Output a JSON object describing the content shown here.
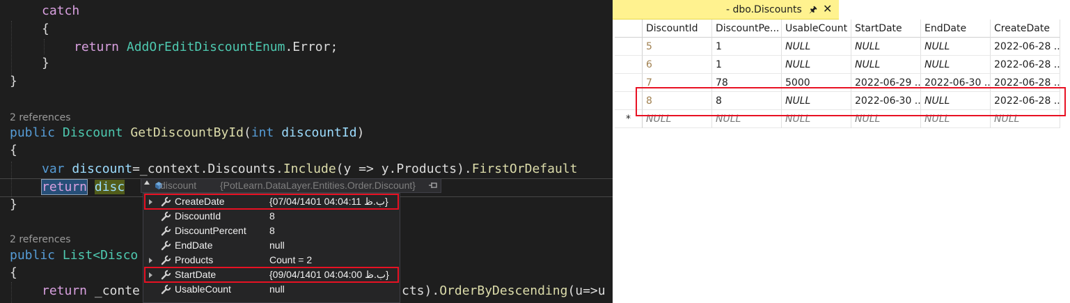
{
  "editor": {
    "code": {
      "catch_kw": "catch",
      "open_brace": "{",
      "close_brace": "}",
      "return_kw": "return",
      "enum_type": "AddOrEditDiscountEnum",
      "enum_tail": ".Error;",
      "refs_1": "2 references",
      "public_kw": "public",
      "discount_type": "Discount",
      "method_1": "GetDiscountById",
      "paren_open": "(",
      "int_kw": "int",
      "param_1": "discountId",
      "paren_close": ")",
      "var_kw": "var",
      "var_name": "discount",
      "ctx_text": "=_context.Discounts.",
      "include_m": "Include",
      "lambda_text": "(y => y.Products).",
      "first_m": "FirstOrDefault",
      "return_sel": "return",
      "disc_sel": "disc",
      "refs_2": "2 references",
      "list_type": "List",
      "list_tail": "<Disco",
      "conte": "_conte",
      "cts_tail": "cts).",
      "order_m": "OrderByDescending",
      "order_tail": "(u=>u"
    },
    "datatip": {
      "header_name": "discount",
      "header_value": "{PotLearn.DataLayer.Entities.Order.Discount}",
      "rows": [
        {
          "name": "CreateDate",
          "value": "{07/04/1401 04:04:11 ب.ظ}",
          "expandable": true,
          "highlighted": true
        },
        {
          "name": "DiscountId",
          "value": "8",
          "expandable": false,
          "highlighted": false
        },
        {
          "name": "DiscountPercent",
          "value": "8",
          "expandable": false,
          "highlighted": false
        },
        {
          "name": "EndDate",
          "value": "null",
          "expandable": false,
          "highlighted": false
        },
        {
          "name": "Products",
          "value": "Count = 2",
          "expandable": true,
          "highlighted": false
        },
        {
          "name": "StartDate",
          "value": "{09/04/1401 04:04:00 ب.ظ}",
          "expandable": true,
          "highlighted": true
        },
        {
          "name": "UsableCount",
          "value": "null",
          "expandable": false,
          "highlighted": false
        }
      ]
    }
  },
  "results": {
    "tab_title": "- dbo.Discounts",
    "pin_icon": "pin-icon",
    "close_icon": "close-icon",
    "columns": [
      "DiscountId",
      "DiscountPe...",
      "UsableCount",
      "StartDate",
      "EndDate",
      "CreateDate"
    ],
    "rows": [
      {
        "marker": "",
        "cells": [
          "5",
          "1",
          "NULL",
          "NULL",
          "NULL",
          "2022-06-28 ..."
        ]
      },
      {
        "marker": "",
        "cells": [
          "6",
          "1",
          "NULL",
          "NULL",
          "NULL",
          "2022-06-28 ..."
        ]
      },
      {
        "marker": "",
        "cells": [
          "7",
          "78",
          "5000",
          "2022-06-29 ...",
          "2022-06-30 ...",
          "2022-06-28 ..."
        ]
      },
      {
        "marker": "",
        "cells": [
          "8",
          "8",
          "NULL",
          "2022-06-30 ...",
          "NULL",
          "2022-06-28 ..."
        ]
      },
      {
        "marker": "*",
        "cells": [
          "NULL",
          "NULL",
          "NULL",
          "NULL",
          "NULL",
          "NULL"
        ]
      }
    ],
    "highlighted_row": 3,
    "colors": {
      "tab_bg": "#fff28f",
      "highlight": "#e81123"
    }
  }
}
